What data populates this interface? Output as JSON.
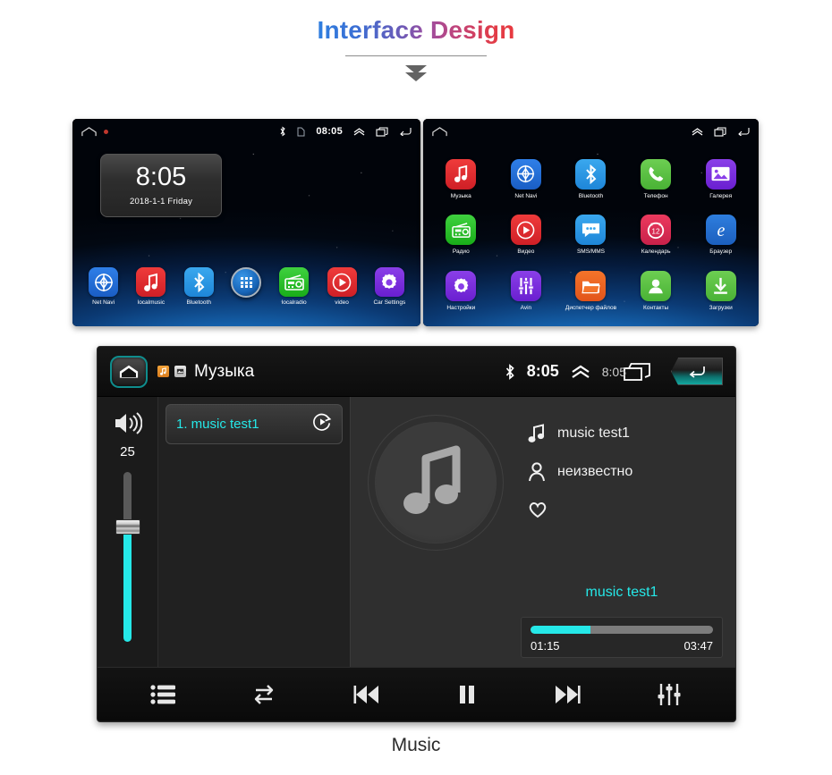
{
  "header": {
    "title": "Interface Design",
    "chevron_icon": "chevron-down-double-icon"
  },
  "home_screen": {
    "status_bar": {
      "home_icon": "home-outline-icon",
      "notification_dot": "red-dot-icon",
      "bluetooth_icon": "bluetooth-icon",
      "sdcard_icon": "sdcard-icon",
      "time": "08:05",
      "expand_icon": "chevron-up-icon",
      "recents_icon": "recents-icon",
      "back_icon": "back-arrow-icon"
    },
    "clock_widget": {
      "time": "8:05",
      "date": "2018-1-1  Friday"
    },
    "dock": [
      {
        "label": "Net Navi",
        "icon": "compass-icon",
        "color": "#2f7fe8"
      },
      {
        "label": "localmusic",
        "icon": "music-note-icon",
        "color": "#ef3b3b"
      },
      {
        "label": "Bluetooth",
        "icon": "bluetooth-icon",
        "color": "#3aa8ee"
      },
      {
        "label": "",
        "icon": "app-drawer-icon",
        "color": "#1663b6"
      },
      {
        "label": "localradio",
        "icon": "radio-icon",
        "color": "#3fd13f"
      },
      {
        "label": "video",
        "icon": "play-circle-icon",
        "color": "#ef3b3b"
      },
      {
        "label": "Car Settings",
        "icon": "gear-icon",
        "color": "#8a3fe8"
      }
    ]
  },
  "app_drawer": {
    "status_bar": {
      "home_icon": "home-outline-icon",
      "expand_icon": "chevron-up-icon",
      "recents_icon": "recents-icon",
      "back_icon": "back-arrow-icon"
    },
    "apps": [
      {
        "label": "Музыка",
        "icon": "music-note-icon",
        "color": "#ef3b3b"
      },
      {
        "label": "Net Navi",
        "icon": "compass-icon",
        "color": "#2f7fe8"
      },
      {
        "label": "Bluetooth",
        "icon": "bluetooth-icon",
        "color": "#3aa8ee"
      },
      {
        "label": "Телефон",
        "icon": "phone-icon",
        "color": "#6dce52"
      },
      {
        "label": "Галерея",
        "icon": "gallery-icon",
        "color": "#8a3fe8"
      },
      {
        "label": "Радио",
        "icon": "radio-icon",
        "color": "#3fd13f"
      },
      {
        "label": "Видео",
        "icon": "play-circle-icon",
        "color": "#ef3b3b"
      },
      {
        "label": "SMS/MMS",
        "icon": "message-bubble-icon",
        "color": "#3aa8ee"
      },
      {
        "label": "Календарь",
        "icon": "calendar-icon",
        "color": "#ec3a5e"
      },
      {
        "label": "Браузер",
        "icon": "browser-e-icon",
        "color": "#2e7ede"
      },
      {
        "label": "Настройки",
        "icon": "gear-icon",
        "color": "#8a3fe8"
      },
      {
        "label": "Avin",
        "icon": "equalizer-icon",
        "color": "#8a3fe8"
      },
      {
        "label": "Диспетчер файлов",
        "icon": "folder-icon",
        "color": "#f4742a"
      },
      {
        "label": "Контакты",
        "icon": "contact-icon",
        "color": "#6dce52"
      },
      {
        "label": "Загрузки",
        "icon": "download-icon",
        "color": "#6dce52"
      }
    ]
  },
  "music_player": {
    "header": {
      "home_button_icon": "home-icon",
      "music_badge_icon": "music-note-icon",
      "sdcard_badge_icon": "sdcard-icon",
      "title": "Музыка",
      "bluetooth_icon": "bluetooth-icon",
      "time": "8:05",
      "expand_icon": "chevron-up-icon",
      "time_secondary": "8:05",
      "recents_icon": "recents-icon",
      "back_button_icon": "back-arrow-icon"
    },
    "volume": {
      "icon": "speaker-volume-icon",
      "value": "25",
      "percent": 70
    },
    "playlist": [
      {
        "label": "1. music test1",
        "icon": "play-circle-arrow-icon"
      }
    ],
    "album_art_icon": "music-note-icon",
    "track_info": {
      "title": "music test1",
      "title_icon": "music-note-icon",
      "artist": "неизвестно",
      "artist_icon": "person-icon",
      "favorite_icon": "heart-icon"
    },
    "now_playing": {
      "title": "music test1",
      "elapsed": "01:15",
      "duration": "03:47",
      "progress_percent": 33
    },
    "controls": [
      {
        "name": "playlist-button",
        "icon": "list-icon"
      },
      {
        "name": "repeat-button",
        "icon": "repeat-icon"
      },
      {
        "name": "previous-button",
        "icon": "previous-track-icon"
      },
      {
        "name": "pause-button",
        "icon": "pause-icon"
      },
      {
        "name": "next-button",
        "icon": "next-track-icon"
      },
      {
        "name": "equalizer-button",
        "icon": "equalizer-icon"
      }
    ],
    "accent_color": "#25e8e8"
  },
  "caption": "Music"
}
